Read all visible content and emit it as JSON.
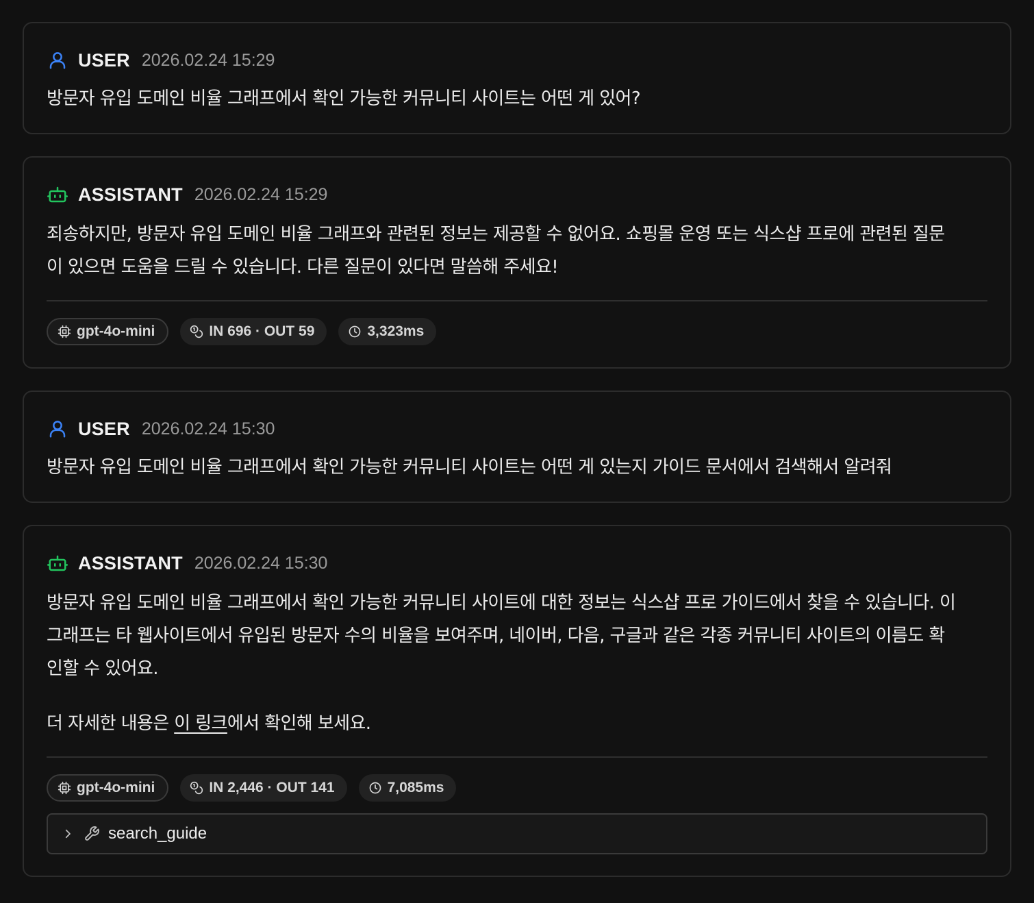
{
  "messages": [
    {
      "role": "USER",
      "timestamp": "2026.02.24 15:29",
      "text": "방문자 유입 도메인 비율 그래프에서 확인 가능한 커뮤니티 사이트는 어떤 게 있어?"
    },
    {
      "role": "ASSISTANT",
      "timestamp": "2026.02.24 15:29",
      "text_line1": "죄송하지만, 방문자 유입 도메인 비율 그래프와 관련된 정보는 제공할 수 없어요. 쇼핑몰 운영 또는 식스샵 프로에 관련된 질문",
      "text_line2": "이 있으면 도움을 드릴 수 있습니다. 다른 질문이 있다면 말씀해 주세요!",
      "model": "gpt-4o-mini",
      "tokens": "IN 696 · OUT 59",
      "latency": "3,323ms"
    },
    {
      "role": "USER",
      "timestamp": "2026.02.24 15:30",
      "text": "방문자 유입 도메인 비율 그래프에서 확인 가능한 커뮤니티 사이트는 어떤 게 있는지 가이드 문서에서 검색해서 알려줘"
    },
    {
      "role": "ASSISTANT",
      "timestamp": "2026.02.24 15:30",
      "text_line1": "방문자 유입 도메인 비율 그래프에서 확인 가능한 커뮤니티 사이트에 대한 정보는 식스샵 프로 가이드에서 찾을 수 있습니다. 이",
      "text_line2": "그래프는 타 웹사이트에서 유입된 방문자 수의 비율을 보여주며, 네이버, 다음, 구글과 같은 각종 커뮤니티 사이트의 이름도 확",
      "text_line3": "인할 수 있어요.",
      "para2_prefix": "더 자세한 내용은 ",
      "para2_link": "이 링크",
      "para2_suffix": "에서 확인해 보세요.",
      "model": "gpt-4o-mini",
      "tokens": "IN 2,446 · OUT 141",
      "latency": "7,085ms",
      "tool_name": "search_guide"
    }
  ],
  "icons": {
    "user": "user-icon",
    "assistant": "bot-icon",
    "model": "cpu-icon",
    "tokens": "coins-icon",
    "latency": "clock-icon",
    "expand": "chevron-right-icon",
    "tool": "wrench-icon"
  },
  "colors": {
    "background": "#111111",
    "user_accent": "#3b82f6",
    "assistant_accent": "#22c55e",
    "border": "#2c2c2c",
    "muted_text": "#9a9a9a"
  }
}
